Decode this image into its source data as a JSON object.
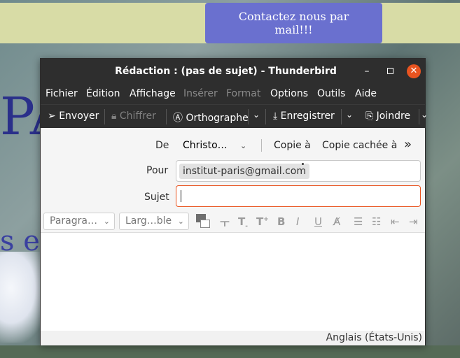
{
  "background": {
    "contact_line1": "Contactez nous par",
    "contact_line2": "mail!!!",
    "big_text": "PA",
    "small_text": "s e"
  },
  "window": {
    "title": "Rédaction : (pas de sujet) - Thunderbird",
    "controls": {
      "minimize": "–",
      "close": "✕"
    }
  },
  "menu": [
    {
      "label": "Fichier",
      "enabled": true
    },
    {
      "label": "Édition",
      "enabled": true
    },
    {
      "label": "Affichage",
      "enabled": true
    },
    {
      "label": "Insérer",
      "enabled": false
    },
    {
      "label": "Format",
      "enabled": false
    },
    {
      "label": "Options",
      "enabled": true
    },
    {
      "label": "Outils",
      "enabled": true
    },
    {
      "label": "Aide",
      "enabled": true
    }
  ],
  "toolbar": {
    "send": "Envoyer",
    "encrypt": "Chiffrer",
    "spelling": "Orthographe",
    "save": "Enregistrer",
    "attach": "Joindre"
  },
  "fields": {
    "from_label": "De",
    "from_value": "Christo…",
    "cc": "Copie à",
    "bcc": "Copie cachée à",
    "more": "»",
    "to_label": "Pour",
    "to_recipient": "institut-paris@gmail.com",
    "subject_label": "Sujet",
    "subject_value": ""
  },
  "format": {
    "paragraph": "Paragra…",
    "font": "Larg…ble"
  },
  "status": {
    "language": "Anglais (États-Unis)"
  },
  "colors": {
    "accent": "#e95420",
    "titlebar": "#2e2e2e",
    "contact_button": "#6a70cf"
  }
}
